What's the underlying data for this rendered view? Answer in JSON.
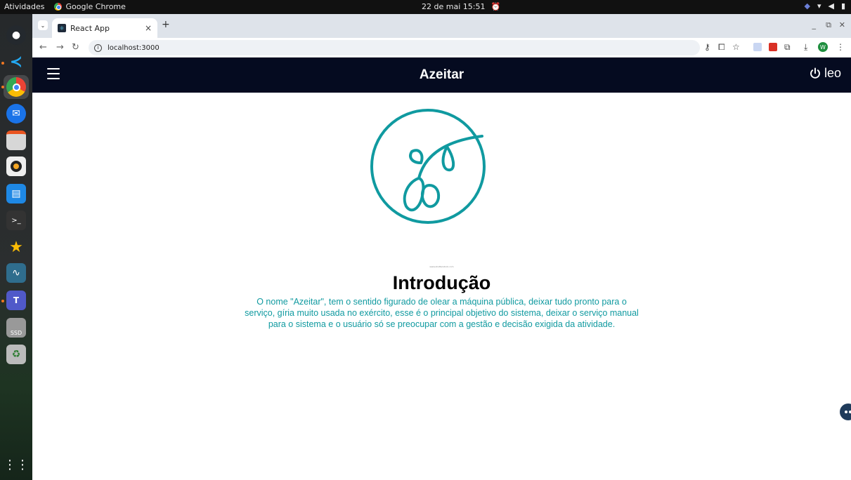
{
  "topbar": {
    "activities": "Atividades",
    "app_name": "Google Chrome",
    "clock": "22 de mai  15:51"
  },
  "dock": {
    "apps": [
      {
        "name": "github-desktop",
        "icon": "github-icon"
      },
      {
        "name": "vscode",
        "icon": "vscode-icon"
      },
      {
        "name": "chrome",
        "icon": "chrome-icon"
      },
      {
        "name": "thunderbird",
        "icon": "thunderbird-icon"
      },
      {
        "name": "files",
        "icon": "folder-icon"
      },
      {
        "name": "rhythmbox",
        "icon": "speaker-icon"
      },
      {
        "name": "writer",
        "icon": "document-icon"
      },
      {
        "name": "terminal",
        "icon": "terminal-icon"
      },
      {
        "name": "starred",
        "icon": "star-icon"
      },
      {
        "name": "mysql-workbench",
        "icon": "dolphin-icon"
      },
      {
        "name": "teams",
        "icon": "teams-icon"
      },
      {
        "name": "ssd",
        "icon": "drive-icon",
        "label": "SSD"
      },
      {
        "name": "trash",
        "icon": "trash-icon"
      }
    ]
  },
  "browser": {
    "tab_title": "React App",
    "url": "localhost:3000"
  },
  "app": {
    "title": "Azeitar",
    "user": "leo",
    "logo_caption": "www.shutterstock.com",
    "intro_title": "Introdução",
    "intro_text": "O nome \"Azeitar\", tem o sentido figurado de olear a máquina pública, deixar tudo pronto para o serviço, gíria muito usada no exército, esse é o principal objetivo do sistema, deixar o serviço manual para o sistema e o usuário só se preocupar com a gestão e decisão exigida da atividade."
  },
  "colors": {
    "appbar": "#050b20",
    "accent": "#109aa0"
  }
}
